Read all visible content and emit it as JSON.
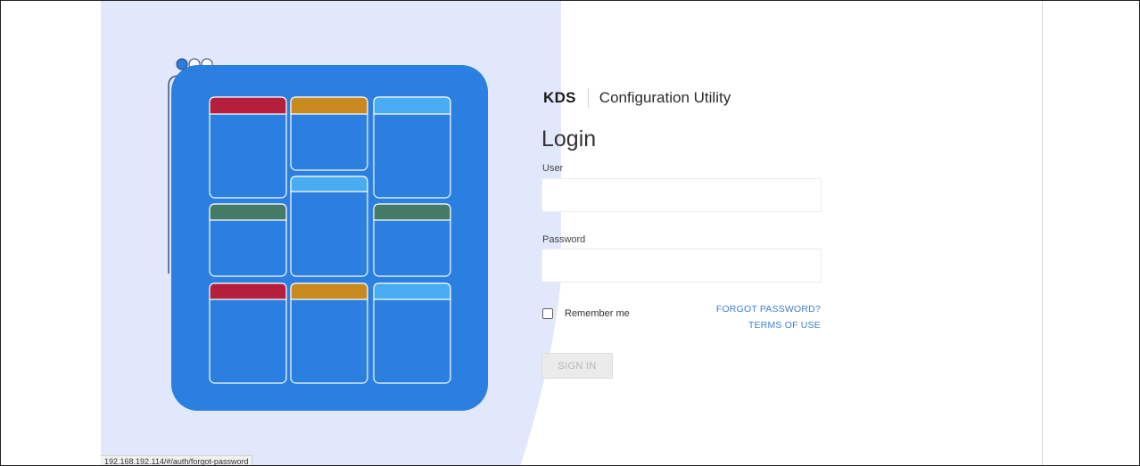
{
  "colors": {
    "hero_background": "#e2e8fb",
    "card_blue": "#2a7fe0",
    "tile_red": "#b51f3b",
    "tile_gold": "#c8891f",
    "tile_light_blue": "#49acf2",
    "tile_green": "#457a66",
    "link_blue": "#3f7fd6"
  },
  "hero": {
    "window_dots": [
      "active",
      "inactive",
      "inactive"
    ]
  },
  "brand": {
    "name": "KDS",
    "app_name": "Configuration Utility"
  },
  "login": {
    "title": "Login",
    "user_label": "User",
    "user_value": "",
    "password_label": "Password",
    "password_value": "",
    "remember_label": "Remember me",
    "remember_checked": false,
    "forgot_password": "FORGOT PASSWORD?",
    "terms_of_use": "TERMS OF USE",
    "sign_in": "SIGN IN"
  },
  "status_bar": {
    "url": "192.168.192.114/#/auth/forgot-password"
  }
}
